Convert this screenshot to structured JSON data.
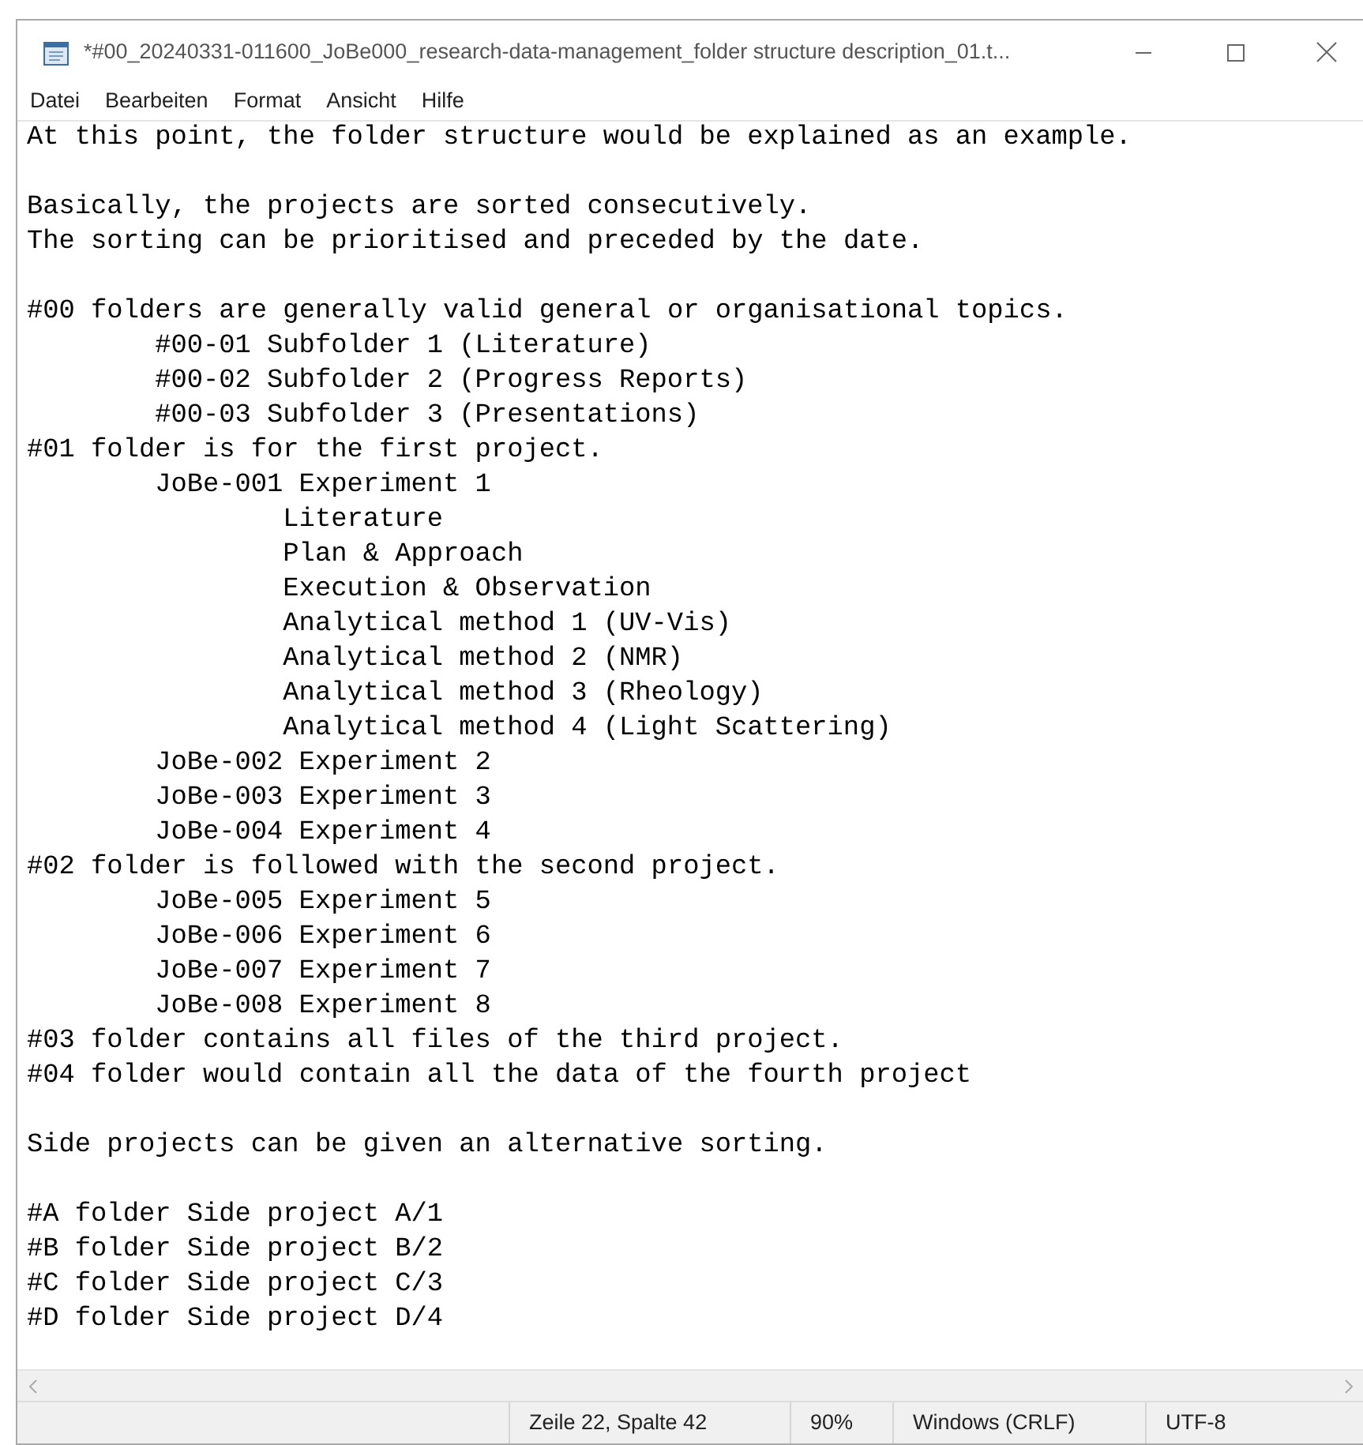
{
  "window": {
    "title": "*#00_20240331-011600_JoBe000_research-data-management_folder structure description_01.t..."
  },
  "menu": [
    "Datei",
    "Bearbeiten",
    "Format",
    "Ansicht",
    "Hilfe"
  ],
  "editor": {
    "lines": [
      {
        "kind": "text",
        "text": "At this point, the folder structure would be explained as an example."
      },
      {
        "kind": "blank"
      },
      {
        "kind": "text",
        "text": "Basically, the projects are sorted consecutively."
      },
      {
        "kind": "text",
        "text": "The sorting can be prioritised and preceded by the date."
      },
      {
        "kind": "blank"
      },
      {
        "kind": "text",
        "text": "#00 folders are generally valid general or organisational topics.",
        "children": [
          {
            "kind": "text",
            "text": "#00-01 Subfolder 1 (Literature)"
          },
          {
            "kind": "text",
            "text": "#00-02 Subfolder 2 (Progress Reports)"
          },
          {
            "kind": "text",
            "text": "#00-03 Subfolder 3 (Presentations)"
          }
        ]
      },
      {
        "kind": "text",
        "text": "#01 folder is for the first project.",
        "children": [
          {
            "kind": "text",
            "text": "JoBe-001 Experiment 1",
            "children": [
              {
                "kind": "text",
                "text": "Literature"
              },
              {
                "kind": "text",
                "text": "Plan & Approach"
              },
              {
                "kind": "text",
                "text": "Execution & Observation"
              },
              {
                "kind": "text",
                "text": "Analytical method 1 (UV-Vis)"
              },
              {
                "kind": "text",
                "text": "Analytical method 2 (NMR)"
              },
              {
                "kind": "text",
                "text": "Analytical method 3 (Rheology)"
              },
              {
                "kind": "text",
                "text": "Analytical method 4 (Light Scattering)"
              }
            ]
          },
          {
            "kind": "text",
            "text": "JoBe-002 Experiment 2"
          },
          {
            "kind": "text",
            "text": "JoBe-003 Experiment 3"
          },
          {
            "kind": "text",
            "text": "JoBe-004 Experiment 4"
          }
        ]
      },
      {
        "kind": "text",
        "text": "#02 folder is followed with the second project.",
        "children": [
          {
            "kind": "text",
            "text": "JoBe-005 Experiment 5"
          },
          {
            "kind": "text",
            "text": "JoBe-006 Experiment 6"
          },
          {
            "kind": "text",
            "text": "JoBe-007 Experiment 7"
          },
          {
            "kind": "text",
            "text": "JoBe-008 Experiment 8"
          }
        ]
      },
      {
        "kind": "text",
        "text": "#03 folder contains all files of the third project."
      },
      {
        "kind": "text",
        "text": "#04 folder would contain all the data of the fourth project"
      },
      {
        "kind": "blank"
      },
      {
        "kind": "text",
        "text": "Side projects can be given an alternative sorting."
      },
      {
        "kind": "blank"
      },
      {
        "kind": "text",
        "text": "#A folder Side project A/1"
      },
      {
        "kind": "text",
        "text": "#B folder Side project B/2"
      },
      {
        "kind": "text",
        "text": "#C folder Side project C/3"
      },
      {
        "kind": "text",
        "text": "#D folder Side project D/4"
      }
    ]
  },
  "status_bar": {
    "position": "Zeile 22, Spalte 42",
    "zoom": "90%",
    "line_ending": "Windows (CRLF)",
    "encoding": "UTF-8"
  }
}
